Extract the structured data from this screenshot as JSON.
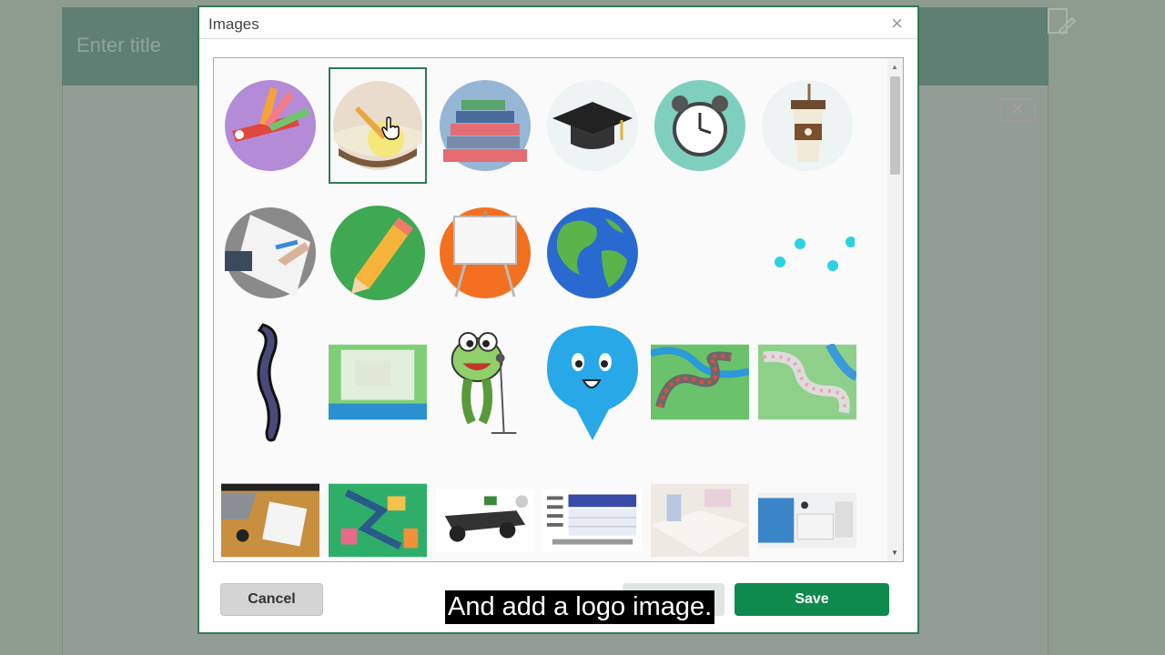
{
  "background": {
    "title_placeholder": "Enter title",
    "icons": [
      "pencil-icon",
      "close-icon"
    ]
  },
  "dialog": {
    "title": "Images",
    "close_icon": "close-icon",
    "images": [
      {
        "name": "colorful-tools",
        "selected": false
      },
      {
        "name": "highlighter-writing",
        "selected": true
      },
      {
        "name": "book-stack",
        "selected": false
      },
      {
        "name": "graduation-cap",
        "selected": false
      },
      {
        "name": "alarm-clock",
        "selected": false
      },
      {
        "name": "coffee-cup",
        "selected": false
      },
      {
        "name": "hand-drawing",
        "selected": false
      },
      {
        "name": "pencil",
        "selected": false
      },
      {
        "name": "whiteboard-easel",
        "selected": false
      },
      {
        "name": "globe",
        "selected": false
      },
      {
        "name": "blank",
        "selected": false
      },
      {
        "name": "cyan-dots",
        "selected": false
      },
      {
        "name": "purple-squiggle",
        "selected": false
      },
      {
        "name": "map-frame",
        "selected": false
      },
      {
        "name": "singing-frog",
        "selected": false
      },
      {
        "name": "smiley-pin",
        "selected": false
      },
      {
        "name": "board-game-path",
        "selected": false
      },
      {
        "name": "winding-path-map",
        "selected": false
      },
      {
        "name": "laptop-desk",
        "selected": false
      },
      {
        "name": "isometric-map",
        "selected": false
      },
      {
        "name": "car-chassis",
        "selected": false
      },
      {
        "name": "infographic-table",
        "selected": false
      },
      {
        "name": "empty-room",
        "selected": false
      },
      {
        "name": "office-interior",
        "selected": false
      }
    ],
    "cancel_label": "Cancel",
    "save_label": "Save"
  },
  "caption": "And add a logo image.",
  "colors": {
    "accent": "#0f8a4e",
    "header": "#5f7f74",
    "selected_border": "#2f7a55"
  }
}
